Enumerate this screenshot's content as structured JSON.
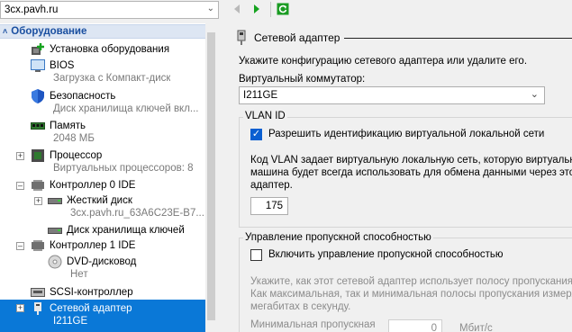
{
  "toolbar": {
    "vm_name": "3cx.pavh.ru"
  },
  "tree": {
    "header": "Оборудование",
    "items": [
      {
        "label": "Установка оборудования",
        "sub": ""
      },
      {
        "label": "BIOS",
        "sub": "Загрузка с Компакт-диск"
      },
      {
        "label": "Безопасность",
        "sub": "Диск хранилища ключей вкл..."
      },
      {
        "label": "Память",
        "sub": "2048 МБ"
      },
      {
        "label": "Процессор",
        "sub": "Виртуальных процессоров: 8"
      },
      {
        "label": "Контроллер 0 IDE",
        "sub": ""
      },
      {
        "label": "Жесткий диск",
        "sub": "3cx.pavh.ru_63A6C23E-B7..."
      },
      {
        "label": "Диск хранилища ключей",
        "sub": ""
      },
      {
        "label": "Контроллер 1 IDE",
        "sub": ""
      },
      {
        "label": "DVD-дисковод",
        "sub": "Нет"
      },
      {
        "label": "SCSI-контроллер",
        "sub": ""
      },
      {
        "label": "Сетевой адаптер",
        "sub": "I211GE"
      }
    ]
  },
  "panel": {
    "title": "Сетевой адаптер",
    "intro": "Укажите конфигурацию сетевого адаптера или удалите его.",
    "switch_label": "Виртуальный коммутатор:",
    "switch_value": "I211GE",
    "vlan": {
      "group_title": "VLAN ID",
      "checkbox_label": "Разрешить идентификацию виртуальной локальной сети",
      "checked": true,
      "desc1": "Код VLAN задает виртуальную локальную сеть, которую виртуальна",
      "desc2": "машина будет всегда использовать для обмена данными через этот с",
      "desc3": "адаптер.",
      "value": "175"
    },
    "bw": {
      "group_title": "Управление пропускной способностью",
      "checkbox_label": "Включить управление пропускной способностью",
      "checked": false,
      "desc1": "Укажите, как этот сетевой адаптер использует полосу пропускания",
      "desc2": "Как максимальная, так и минимальная полосы пропускания измеряют",
      "desc3": "мегабитах в секунду.",
      "min_label_line1": "Минимальная пропускная",
      "min_value": "0",
      "unit": "Мбит/с"
    }
  },
  "colors": {
    "selection": "#0a78d7",
    "header_text": "#1a4fa0",
    "checkbox_on": "#0a5fd1"
  }
}
